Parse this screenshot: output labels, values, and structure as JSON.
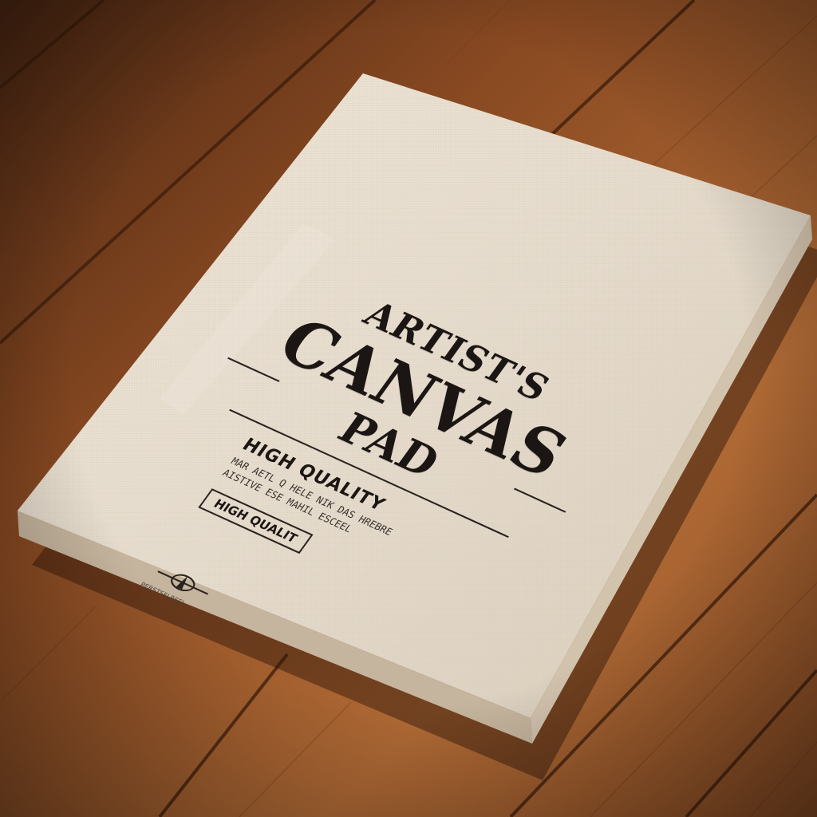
{
  "pad": {
    "title_line1": "ARTIST'S",
    "title_line2": "CANVAS",
    "title_line3": "PAD",
    "subtitle": "HIGH QUALITY",
    "fine_print_1": "MAR AETL Q HELE NIK DAS HREBRE",
    "fine_print_2": "AISTIVE ESE MAHIL ESCEEL",
    "badge": "HIGH QUALIT",
    "logo_caption": "PERSTSFLREEI"
  },
  "colors": {
    "wood_dark": "#5a2f16",
    "wood_mid": "#8a4a22",
    "wood_light": "#b06a35",
    "canvas": "#e6dccd",
    "ink": "#1b1613"
  },
  "icons": [
    "logo-emblem-icon"
  ]
}
